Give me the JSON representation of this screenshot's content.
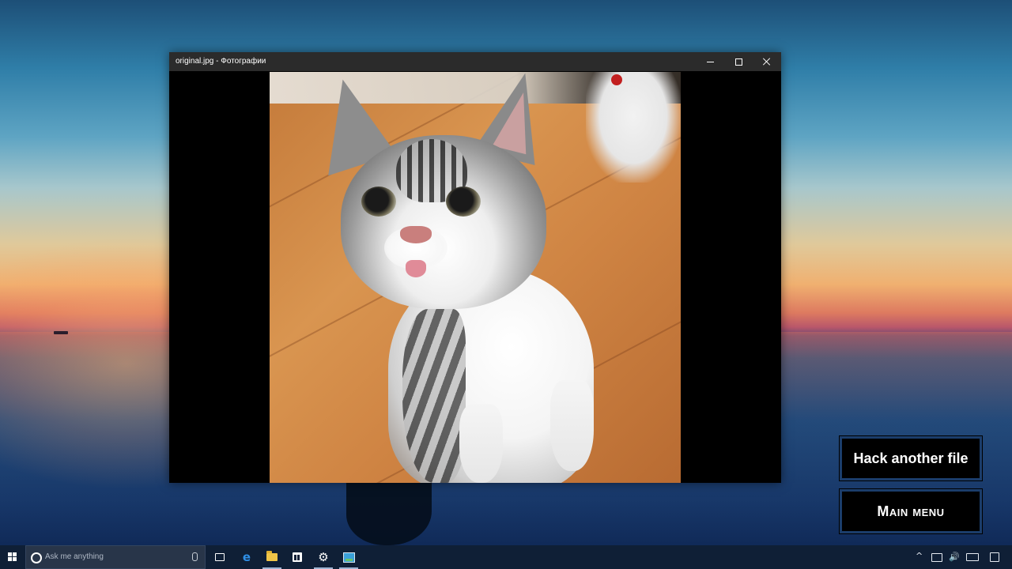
{
  "window": {
    "title": "original.jpg - Фотографии",
    "content": "cat photo"
  },
  "game_menu": {
    "hack_label": "Hack another file",
    "main_menu_label": "Main menu"
  },
  "taskbar": {
    "search_placeholder": "Ask me anything",
    "edge_glyph": "e",
    "settings_glyph": "⚙",
    "apps": [
      "task-view",
      "edge",
      "file-explorer",
      "store",
      "settings",
      "photos-app"
    ],
    "active_indicator_color": "#9db4d3"
  },
  "tray": {
    "chevron_glyph": "^",
    "volume_glyph": "🔊"
  },
  "colors": {
    "taskbar_bg": "#0f1f36",
    "title_bar_bg": "#2b2b2b",
    "game_button_border": "#1b3d6b"
  }
}
